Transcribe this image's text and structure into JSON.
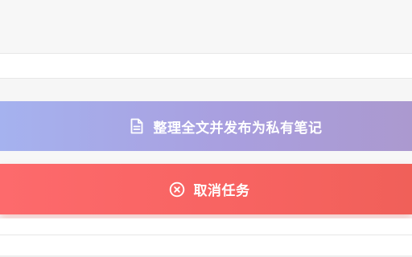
{
  "actions": {
    "publish": {
      "label": "整理全文并发布为私有笔记",
      "icon": "document-icon"
    },
    "cancel": {
      "label": "取消任务",
      "icon": "close-circle-icon"
    }
  },
  "colors": {
    "publish_gradient_start": "#a5b2ef",
    "publish_gradient_end": "#ab99cf",
    "cancel_gradient_start": "#fd6a6c",
    "cancel_gradient_end": "#f06059",
    "text": "#ffffff"
  }
}
